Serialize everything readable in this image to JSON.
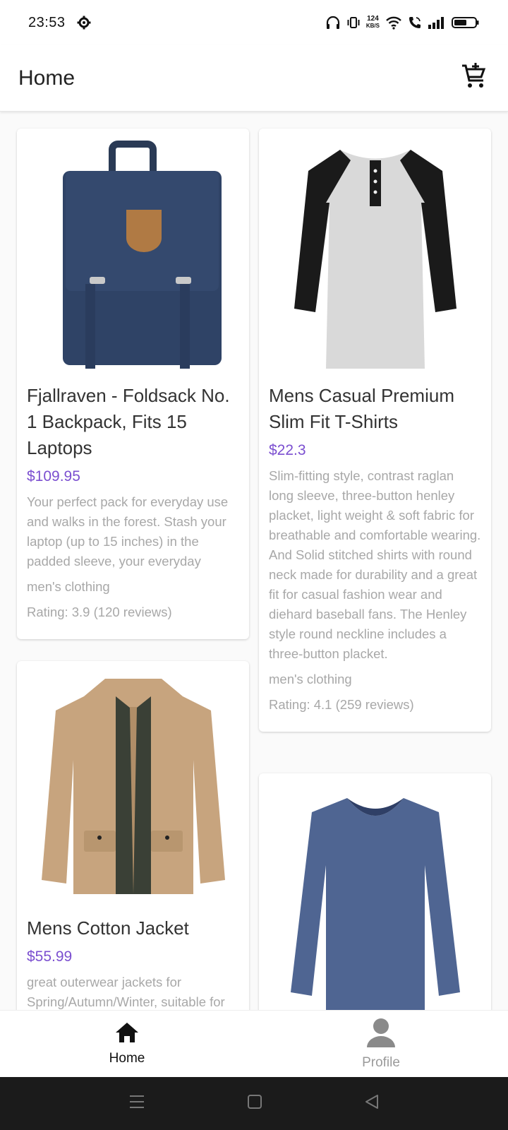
{
  "status": {
    "time": "23:53",
    "net_speed_top": "124",
    "net_speed_bottom": "KB/S"
  },
  "app_bar": {
    "title": "Home"
  },
  "products": [
    {
      "title": "Fjallraven - Foldsack No. 1 Backpack, Fits 15 Laptops",
      "price": "$109.95",
      "description": "Your perfect pack for everyday use and walks in the forest. Stash your laptop (up to 15 inches) in the padded sleeve, your everyday",
      "category": "men's clothing",
      "rating": "Rating: 3.9 (120 reviews)",
      "image_icon": "backpack-image"
    },
    {
      "title": "Mens Casual Premium Slim Fit T-Shirts",
      "price": "$22.3",
      "description": "Slim-fitting style, contrast raglan long sleeve, three-button henley placket, light weight & soft fabric for breathable and comfortable wearing. And Solid stitched shirts with round neck made for durability and a great fit for casual fashion wear and diehard baseball fans. The Henley style round neckline includes a three-button placket.",
      "category": "men's clothing",
      "rating": "Rating: 4.1 (259 reviews)",
      "image_icon": "tshirt-image"
    },
    {
      "title": "Mens Cotton Jacket",
      "price": "$55.99",
      "description": "great outerwear jackets for Spring/Autumn/Winter, suitable for",
      "image_icon": "jacket-image"
    },
    {
      "image_icon": "longsleeve-shirt-image"
    }
  ],
  "bottom_nav": {
    "home_label": "Home",
    "profile_label": "Profile"
  },
  "colors": {
    "price": "#7b4fd0",
    "muted": "#a8a8a8"
  }
}
